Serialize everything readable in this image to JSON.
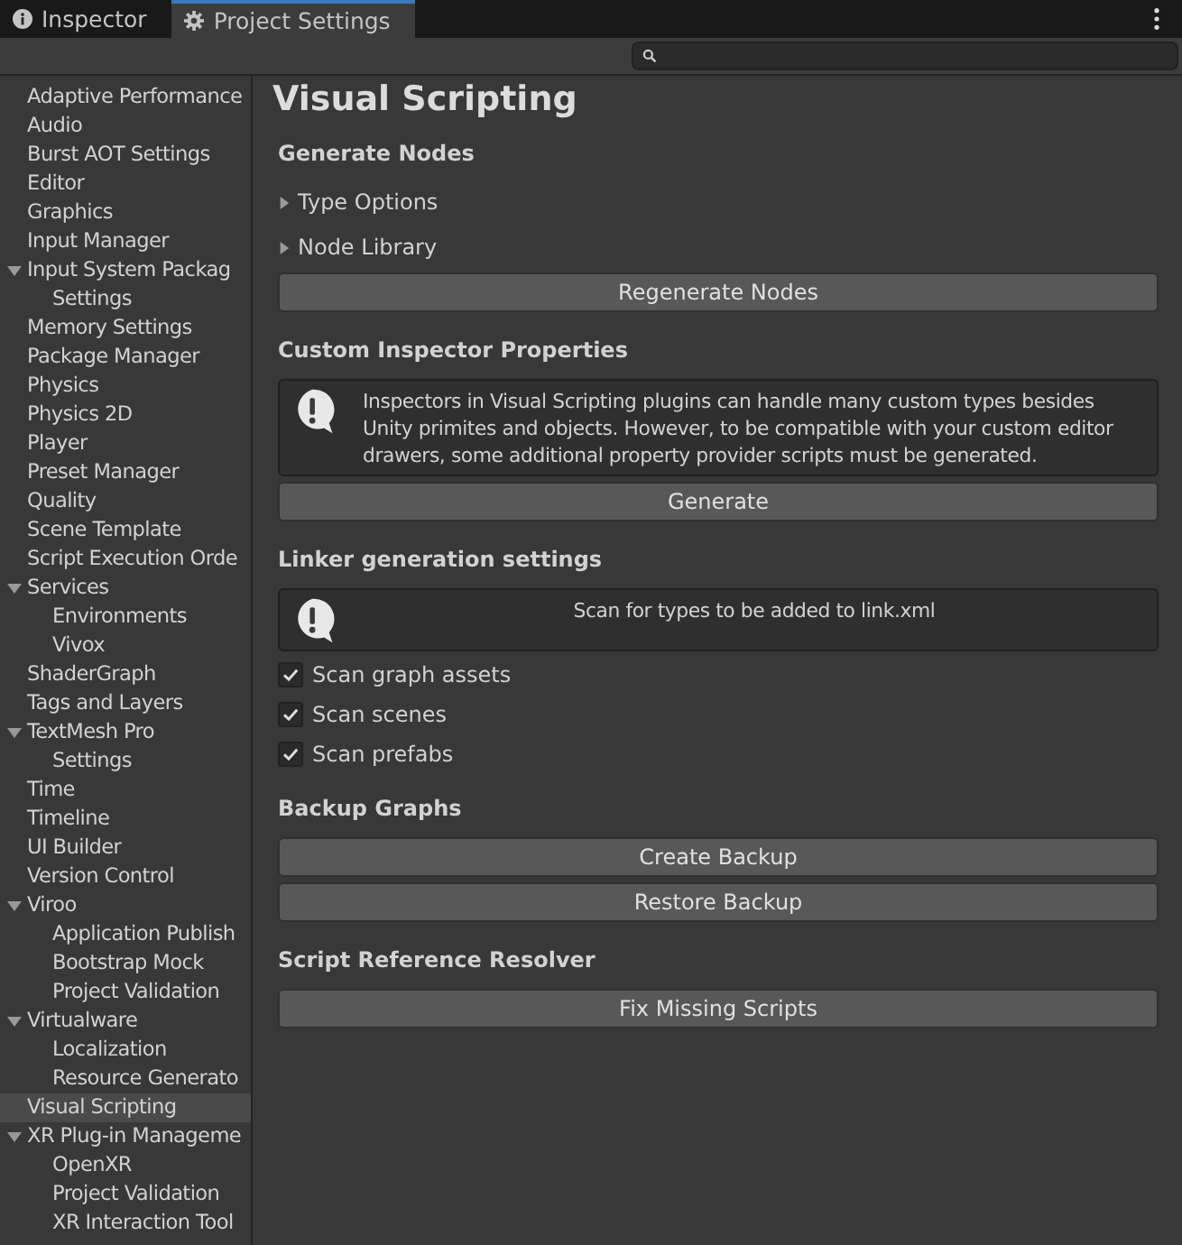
{
  "tabs": [
    {
      "label": "Inspector",
      "selected": false
    },
    {
      "label": "Project Settings",
      "selected": true
    }
  ],
  "sidebar": {
    "items": [
      {
        "label": "Adaptive Performance",
        "selected": false
      },
      {
        "label": "Audio",
        "selected": false
      },
      {
        "label": "Burst AOT Settings",
        "selected": false
      },
      {
        "label": "Editor",
        "selected": false
      },
      {
        "label": "Graphics",
        "selected": false
      },
      {
        "label": "Input Manager",
        "selected": false
      },
      {
        "label": "Input System Packag",
        "selected": false,
        "expanded": true,
        "children": [
          {
            "label": "Settings",
            "selected": false
          }
        ]
      },
      {
        "label": "Memory Settings",
        "selected": false
      },
      {
        "label": "Package Manager",
        "selected": false
      },
      {
        "label": "Physics",
        "selected": false
      },
      {
        "label": "Physics 2D",
        "selected": false
      },
      {
        "label": "Player",
        "selected": false
      },
      {
        "label": "Preset Manager",
        "selected": false
      },
      {
        "label": "Quality",
        "selected": false
      },
      {
        "label": "Scene Template",
        "selected": false
      },
      {
        "label": "Script Execution Orde",
        "selected": false
      },
      {
        "label": "Services",
        "selected": false,
        "expanded": true,
        "children": [
          {
            "label": "Environments",
            "selected": false
          },
          {
            "label": "Vivox",
            "selected": false
          }
        ]
      },
      {
        "label": "ShaderGraph",
        "selected": false
      },
      {
        "label": "Tags and Layers",
        "selected": false
      },
      {
        "label": "TextMesh Pro",
        "selected": false,
        "expanded": true,
        "children": [
          {
            "label": "Settings",
            "selected": false
          }
        ]
      },
      {
        "label": "Time",
        "selected": false
      },
      {
        "label": "Timeline",
        "selected": false
      },
      {
        "label": "UI Builder",
        "selected": false
      },
      {
        "label": "Version Control",
        "selected": false
      },
      {
        "label": "Viroo",
        "selected": false,
        "expanded": true,
        "children": [
          {
            "label": "Application Publish",
            "selected": false
          },
          {
            "label": "Bootstrap Mock",
            "selected": false
          },
          {
            "label": "Project Validation",
            "selected": false
          }
        ]
      },
      {
        "label": "Virtualware",
        "selected": false,
        "expanded": true,
        "children": [
          {
            "label": "Localization",
            "selected": false
          },
          {
            "label": "Resource Generato",
            "selected": false
          }
        ]
      },
      {
        "label": "Visual Scripting",
        "selected": true
      },
      {
        "label": "XR Plug-in Manageme",
        "selected": false,
        "expanded": true,
        "children": [
          {
            "label": "OpenXR",
            "selected": false
          },
          {
            "label": "Project Validation",
            "selected": false
          },
          {
            "label": "XR Interaction Tool",
            "selected": false
          }
        ]
      }
    ]
  },
  "title": "Visual Scripting",
  "sections": [
    {
      "heading": "Generate Nodes",
      "items": [
        {
          "kind": "foldout",
          "label": "Type Options",
          "expanded": false
        },
        {
          "kind": "foldout",
          "label": "Node Library",
          "expanded": false
        },
        {
          "kind": "button",
          "label": "Regenerate Nodes"
        }
      ]
    },
    {
      "heading": "Custom Inspector Properties",
      "items": [
        {
          "kind": "helpbox",
          "text": "Inspectors in Visual Scripting plugins can handle many custom types besides Unity primites and objects. However, to be compatible with your custom editor drawers, some additional property provider scripts must be generated."
        },
        {
          "kind": "button",
          "label": "Generate"
        }
      ]
    },
    {
      "heading": "Linker generation settings",
      "items": [
        {
          "kind": "notice",
          "text": "Scan for types to be added to link.xml"
        },
        {
          "kind": "checkbox",
          "label": "Scan graph assets",
          "checked": true
        },
        {
          "kind": "checkbox",
          "label": "Scan scenes",
          "checked": true
        },
        {
          "kind": "checkbox",
          "label": "Scan prefabs",
          "checked": true
        }
      ]
    },
    {
      "heading": "Backup Graphs",
      "items": [
        {
          "kind": "button",
          "label": "Create Backup"
        },
        {
          "kind": "button",
          "label": "Restore Backup"
        }
      ]
    },
    {
      "heading": "Script Reference Resolver",
      "items": [
        {
          "kind": "button",
          "label": "Fix Missing Scripts"
        }
      ]
    }
  ]
}
